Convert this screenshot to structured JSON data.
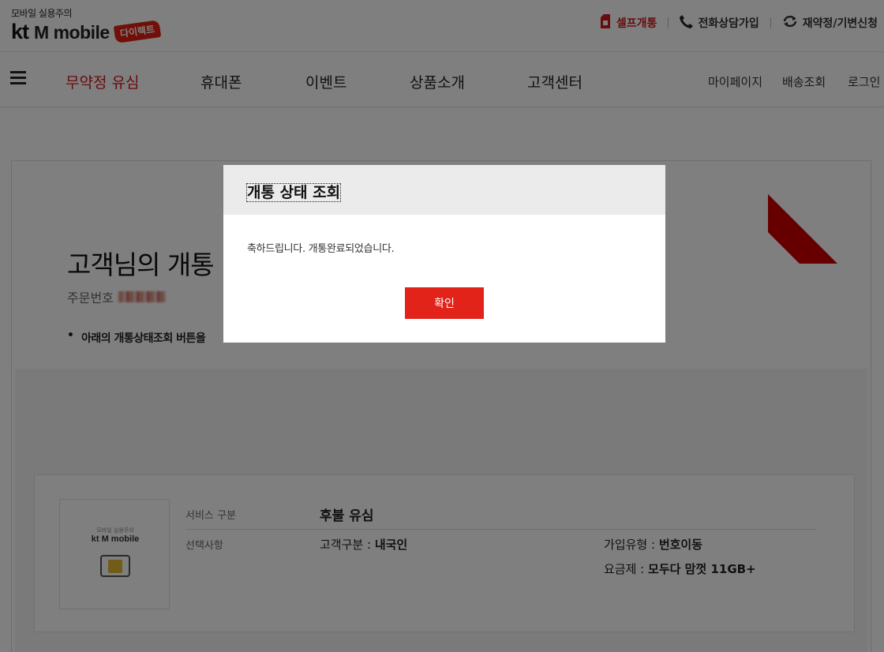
{
  "header": {
    "logo_tagline": "모바일 실용주의",
    "logo_kt": "kt",
    "logo_mobile": "M mobile",
    "logo_badge": "다이렉트",
    "util": {
      "self_open": "셀프개통",
      "phone_signup": "전화상담가입",
      "renew": "재약정/기변신청"
    }
  },
  "nav": {
    "menu": [
      "무약정 유심",
      "휴대폰",
      "이벤트",
      "상품소개",
      "고객센터"
    ],
    "submenu": [
      "마이페이지",
      "배송조회",
      "로그인"
    ]
  },
  "main": {
    "title": "고객님의 개통",
    "order_label": "주문번호",
    "bullet": "아래의 개통상태조회 버튼을"
  },
  "product": {
    "sim_tagline": "모바일 실용주의",
    "sim_logo": "kt M mobile",
    "service_label": "서비스 구분",
    "service_value": "후불 유심",
    "option_label": "선택사항",
    "customer_type_label": "고객구분 :",
    "customer_type_value": "내국인",
    "join_type_label": "가입유형 :",
    "join_type_value": "번호이동",
    "plan_label": "요금제 :",
    "plan_value": "모두다 맘껏 11GB+"
  },
  "modal": {
    "title": "개통 상태 조회",
    "message": "축하드립니다. 개통완료되었습니다.",
    "confirm": "확인"
  },
  "colors": {
    "brand_red": "#e2231a",
    "nav_active": "#d0191e",
    "overlay": "rgba(0,0,0,0.5)"
  }
}
